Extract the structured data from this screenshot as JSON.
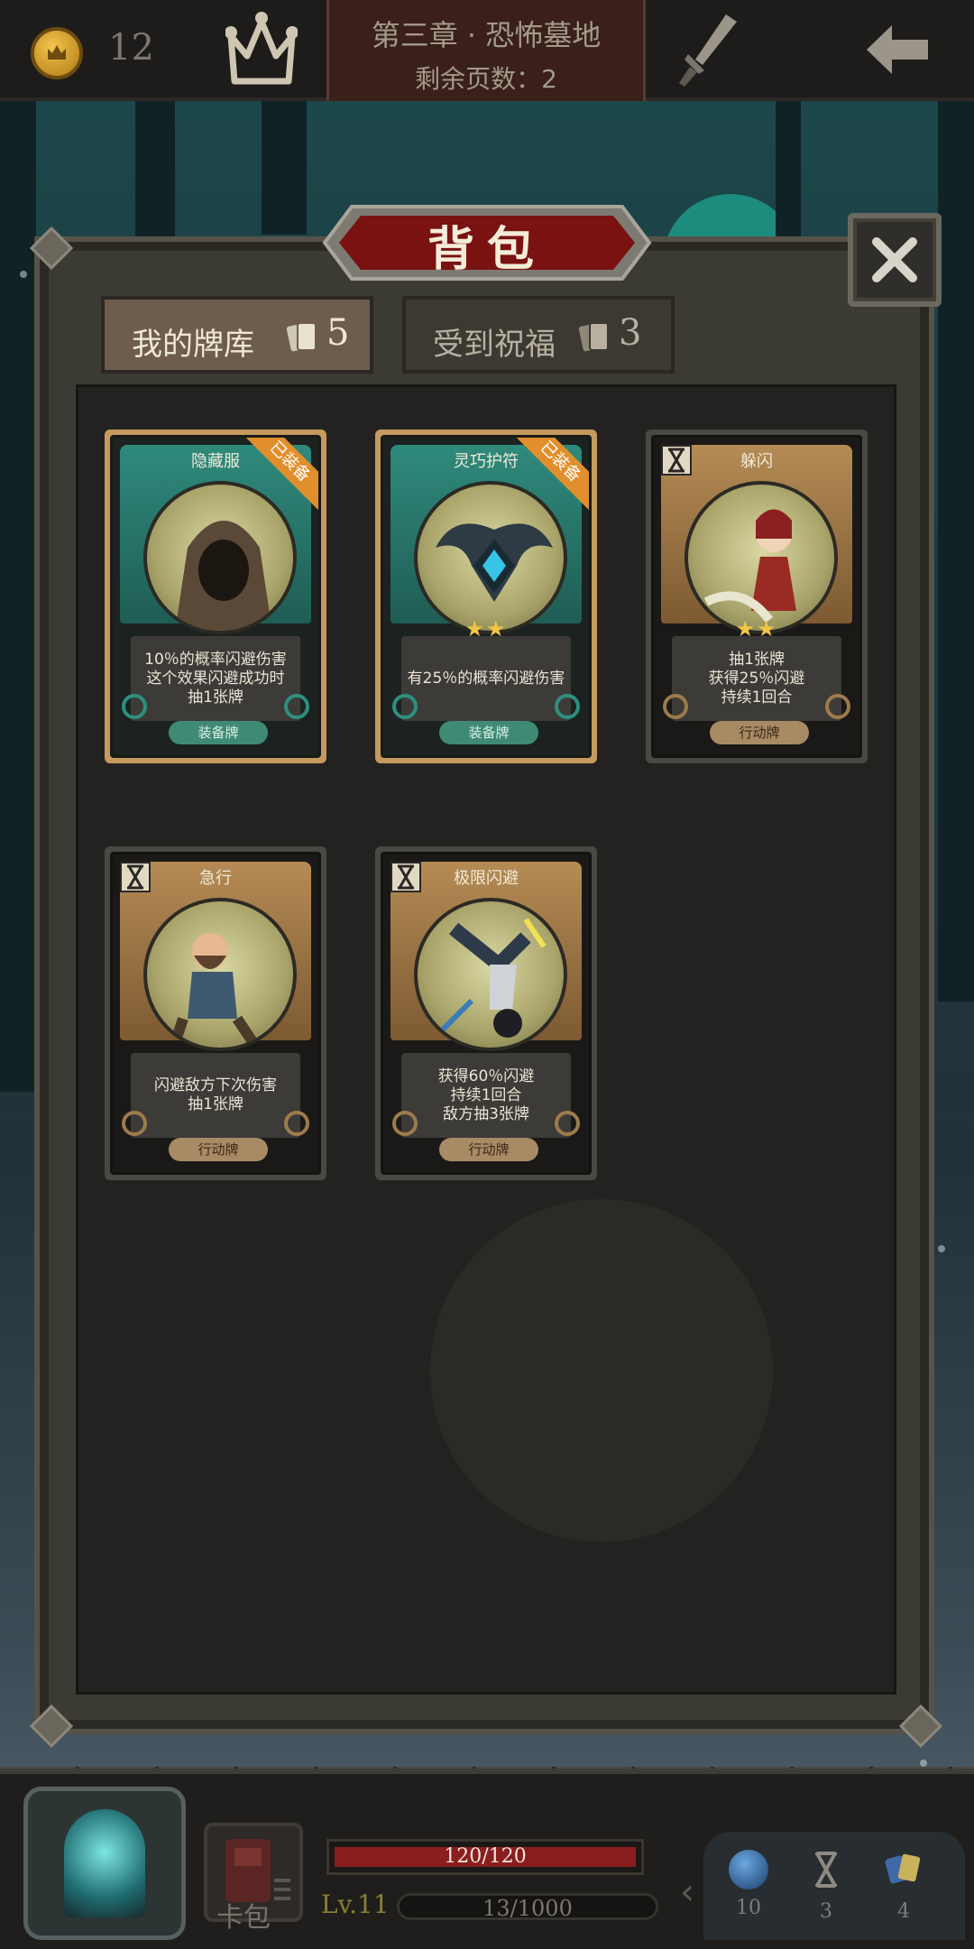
{
  "top_bar": {
    "gold": "12",
    "chapter_title": "第三章 · 恐怖墓地",
    "pages_remaining": "剩余页数：2"
  },
  "panel": {
    "title": "背包",
    "tabs": [
      {
        "label": "我的牌库",
        "count": "5",
        "active": true
      },
      {
        "label": "受到祝福",
        "count": "3",
        "active": false
      }
    ]
  },
  "cards": [
    {
      "name": "隐藏服",
      "badge": "已装备",
      "stars": "",
      "desc": [
        "10％的概率闪避伤害",
        "这个效果闪避成功时",
        "抽1张牌"
      ],
      "type": "装备牌",
      "kind": "equip"
    },
    {
      "name": "灵巧护符",
      "badge": "已装备",
      "stars": "★★",
      "desc": [
        "有25％的概率闪避伤害"
      ],
      "type": "装备牌",
      "kind": "equip"
    },
    {
      "name": "躲闪",
      "badge": "",
      "stars": "★★",
      "desc": [
        "抽1张牌",
        "获得25％闪避",
        "持续1回合"
      ],
      "type": "行动牌",
      "kind": "action"
    },
    {
      "name": "急行",
      "badge": "",
      "stars": "",
      "desc": [
        "闪避敌方下次伤害",
        "抽1张牌"
      ],
      "type": "行动牌",
      "kind": "action"
    },
    {
      "name": "极限闪避",
      "badge": "",
      "stars": "",
      "desc": [
        "获得60％闪避",
        "持续1回合",
        "敌方抽3张牌"
      ],
      "type": "行动牌",
      "kind": "action"
    }
  ],
  "bottom_bar": {
    "card_pack_label": "卡包",
    "hp_text": "120/120",
    "hp_fraction": 1.0,
    "level": "Lv.11",
    "xp_text": "13/1000",
    "resources": [
      {
        "icon": "mana-orb-icon",
        "value": "10"
      },
      {
        "icon": "hourglass-icon",
        "value": "3"
      },
      {
        "icon": "cards-icon",
        "value": "4"
      }
    ]
  },
  "colors": {
    "equip_frame": "#c49a5e",
    "equip_header": "#2f8a7c",
    "action_header": "#b58b55",
    "badge": "#e18f2d",
    "hp_fill": "#8a1d1d"
  }
}
